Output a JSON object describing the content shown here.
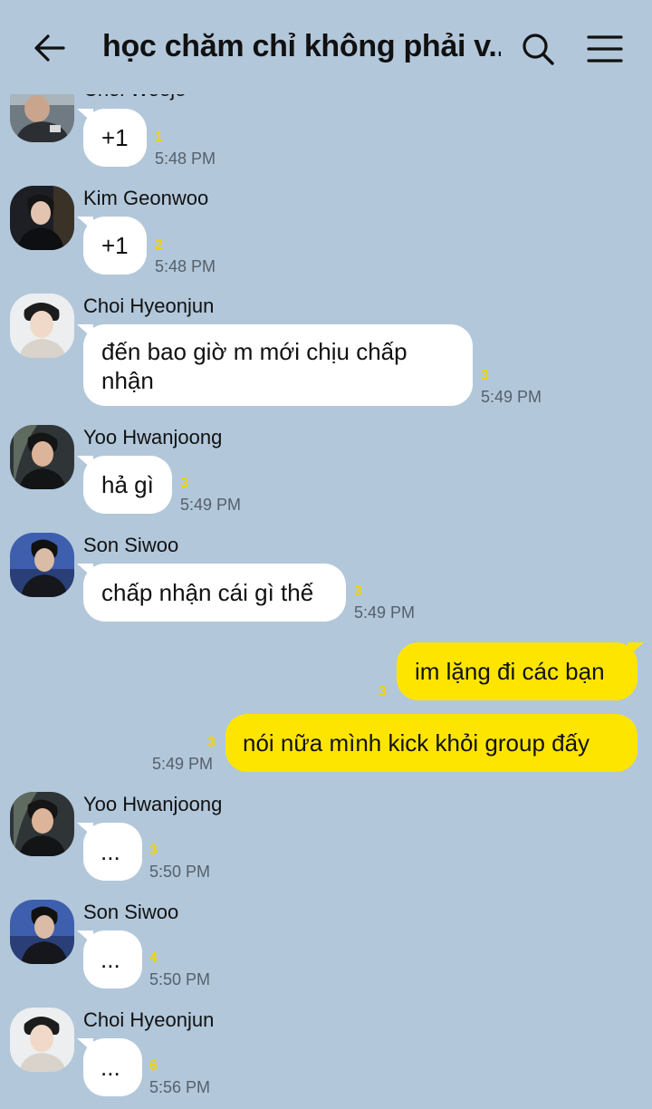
{
  "header": {
    "title": "học chăm chỉ không phải v...",
    "back_icon": "back-arrow-icon",
    "search_icon": "search-icon",
    "menu_icon": "hamburger-menu-icon"
  },
  "colors": {
    "background": "#b2c7da",
    "my_bubble": "#fee500",
    "other_bubble": "#ffffff",
    "unread": "#f3d400"
  },
  "messages": [
    {
      "sender": "Choi Woeje",
      "text": "+1",
      "unread": "1",
      "time": "5:48 PM"
    },
    {
      "sender": "Kim Geonwoo",
      "text": "+1",
      "unread": "2",
      "time": "5:48 PM"
    },
    {
      "sender": "Choi Hyeonjun",
      "text_line1": "đến bao giờ m mới chịu chấp",
      "text_line2": "nhận",
      "unread": "3",
      "time": "5:49 PM"
    },
    {
      "sender": "Yoo Hwanjoong",
      "text": "hả gì",
      "unread": "3",
      "time": "5:49 PM"
    },
    {
      "sender": "Son Siwoo",
      "text": "chấp nhận cái gì thế",
      "unread": "3",
      "time": "5:49 PM"
    },
    {
      "sender": "me",
      "text": "im lặng đi các bạn",
      "unread": "3",
      "time": ""
    },
    {
      "sender": "me",
      "text": "nói nữa mình kick khỏi group đấy",
      "unread": "3",
      "time": "5:49 PM"
    },
    {
      "sender": "Yoo Hwanjoong",
      "text": "...",
      "unread": "3",
      "time": "5:50 PM"
    },
    {
      "sender": "Son Siwoo",
      "text": "...",
      "unread": "4",
      "time": "5:50 PM"
    },
    {
      "sender": "Choi Hyeonjun",
      "text": "...",
      "unread": "6",
      "time": "5:56 PM"
    }
  ]
}
